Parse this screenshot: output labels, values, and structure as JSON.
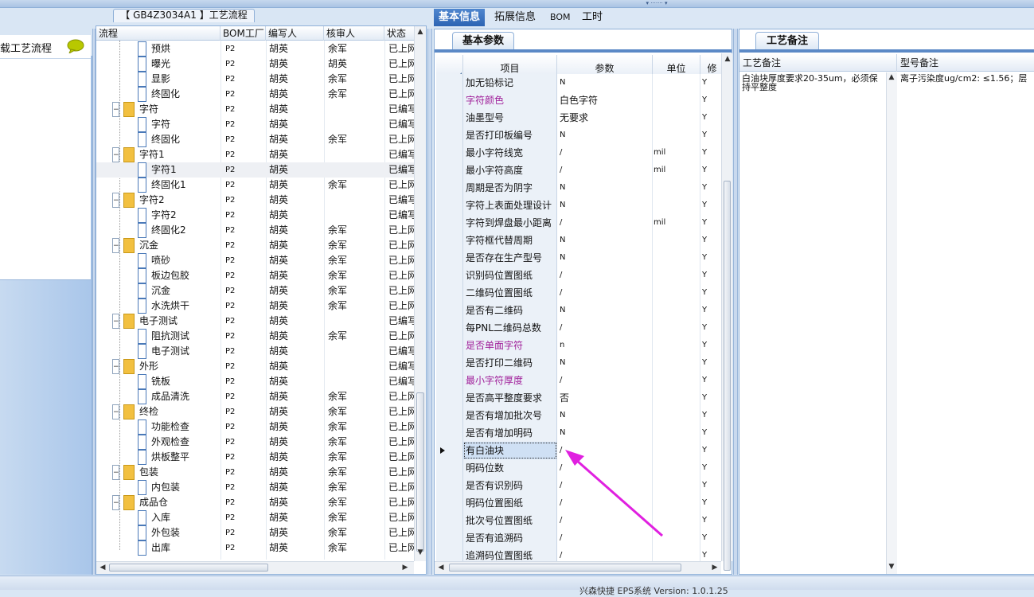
{
  "footer": {
    "version": "兴森快捷 EPS系统 Version: 1.0.1.25"
  },
  "left": {
    "item_label": "载工艺流程"
  },
  "tree": {
    "tab_label": "【 GB4Z3034A1 】工艺流程",
    "columns": [
      "流程",
      "BOM工厂",
      "编写人",
      "核审人",
      "状态"
    ],
    "rows": [
      {
        "type": "doc",
        "name": "预烘",
        "bom": "P2",
        "writer": "胡英",
        "reviewer": "余军",
        "status": "已上网"
      },
      {
        "type": "doc",
        "name": "曝光",
        "bom": "P2",
        "writer": "胡英",
        "reviewer": "胡英",
        "status": "已上网"
      },
      {
        "type": "doc",
        "name": "显影",
        "bom": "P2",
        "writer": "胡英",
        "reviewer": "余军",
        "status": "已上网"
      },
      {
        "type": "doc",
        "name": "终固化",
        "bom": "P2",
        "writer": "胡英",
        "reviewer": "余军",
        "status": "已上网"
      },
      {
        "type": "folder",
        "name": "字符",
        "bom": "P2",
        "writer": "胡英",
        "reviewer": "",
        "status": "已编写"
      },
      {
        "type": "doc",
        "name": "字符",
        "bom": "P2",
        "writer": "胡英",
        "reviewer": "",
        "status": "已编写"
      },
      {
        "type": "doc",
        "name": "终固化",
        "bom": "P2",
        "writer": "胡英",
        "reviewer": "余军",
        "status": "已上网"
      },
      {
        "type": "folder",
        "name": "字符1",
        "bom": "P2",
        "writer": "胡英",
        "reviewer": "",
        "status": "已编写"
      },
      {
        "type": "doc",
        "name": "字符1",
        "bom": "P2",
        "writer": "胡英",
        "reviewer": "",
        "status": "已编写",
        "selected": true
      },
      {
        "type": "doc",
        "name": "终固化1",
        "bom": "P2",
        "writer": "胡英",
        "reviewer": "余军",
        "status": "已上网"
      },
      {
        "type": "folder",
        "name": "字符2",
        "bom": "P2",
        "writer": "胡英",
        "reviewer": "",
        "status": "已编写"
      },
      {
        "type": "doc",
        "name": "字符2",
        "bom": "P2",
        "writer": "胡英",
        "reviewer": "",
        "status": "已编写"
      },
      {
        "type": "doc",
        "name": "终固化2",
        "bom": "P2",
        "writer": "胡英",
        "reviewer": "余军",
        "status": "已上网"
      },
      {
        "type": "folder",
        "name": "沉金",
        "bom": "P2",
        "writer": "胡英",
        "reviewer": "余军",
        "status": "已上网"
      },
      {
        "type": "doc",
        "name": "喷砂",
        "bom": "P2",
        "writer": "胡英",
        "reviewer": "余军",
        "status": "已上网"
      },
      {
        "type": "doc",
        "name": "板边包胶",
        "bom": "P2",
        "writer": "胡英",
        "reviewer": "余军",
        "status": "已上网"
      },
      {
        "type": "doc",
        "name": "沉金",
        "bom": "P2",
        "writer": "胡英",
        "reviewer": "余军",
        "status": "已上网"
      },
      {
        "type": "doc",
        "name": "水洗烘干",
        "bom": "P2",
        "writer": "胡英",
        "reviewer": "余军",
        "status": "已上网"
      },
      {
        "type": "folder",
        "name": "电子测试",
        "bom": "P2",
        "writer": "胡英",
        "reviewer": "",
        "status": "已编写"
      },
      {
        "type": "doc",
        "name": "阻抗测试",
        "bom": "P2",
        "writer": "胡英",
        "reviewer": "余军",
        "status": "已上网"
      },
      {
        "type": "doc",
        "name": "电子测试",
        "bom": "P2",
        "writer": "胡英",
        "reviewer": "",
        "status": "已编写"
      },
      {
        "type": "folder",
        "name": "外形",
        "bom": "P2",
        "writer": "胡英",
        "reviewer": "",
        "status": "已编写"
      },
      {
        "type": "doc",
        "name": "铣板",
        "bom": "P2",
        "writer": "胡英",
        "reviewer": "",
        "status": "已编写"
      },
      {
        "type": "doc",
        "name": "成品清洗",
        "bom": "P2",
        "writer": "胡英",
        "reviewer": "余军",
        "status": "已上网"
      },
      {
        "type": "folder",
        "name": "终检",
        "bom": "P2",
        "writer": "胡英",
        "reviewer": "余军",
        "status": "已上网"
      },
      {
        "type": "doc",
        "name": "功能检查",
        "bom": "P2",
        "writer": "胡英",
        "reviewer": "余军",
        "status": "已上网"
      },
      {
        "type": "doc",
        "name": "外观检查",
        "bom": "P2",
        "writer": "胡英",
        "reviewer": "余军",
        "status": "已上网"
      },
      {
        "type": "doc",
        "name": "烘板整平",
        "bom": "P2",
        "writer": "胡英",
        "reviewer": "余军",
        "status": "已上网"
      },
      {
        "type": "folder",
        "name": "包装",
        "bom": "P2",
        "writer": "胡英",
        "reviewer": "余军",
        "status": "已上网"
      },
      {
        "type": "doc",
        "name": "内包装",
        "bom": "P2",
        "writer": "胡英",
        "reviewer": "余军",
        "status": "已上网"
      },
      {
        "type": "folder",
        "name": "成品仓",
        "bom": "P2",
        "writer": "胡英",
        "reviewer": "余军",
        "status": "已上网"
      },
      {
        "type": "doc",
        "name": "入库",
        "bom": "P2",
        "writer": "胡英",
        "reviewer": "余军",
        "status": "已上网"
      },
      {
        "type": "doc",
        "name": "外包装",
        "bom": "P2",
        "writer": "胡英",
        "reviewer": "余军",
        "status": "已上网"
      },
      {
        "type": "doc",
        "name": "出库",
        "bom": "P2",
        "writer": "胡英",
        "reviewer": "余军",
        "status": "已上网"
      }
    ]
  },
  "main_tabs": [
    "基本信息",
    "拓展信息",
    "BOM",
    "工时"
  ],
  "params": {
    "subtab": "基本参数",
    "columns": [
      "项目",
      "参数",
      "单位",
      "修"
    ],
    "rows": [
      {
        "item": "加无铅标记",
        "value": "N",
        "unit": "",
        "flag": "Y"
      },
      {
        "item": "字符颜色",
        "value": "白色字符",
        "unit": "",
        "flag": "Y",
        "hl": true
      },
      {
        "item": "油墨型号",
        "value": "无要求",
        "unit": "",
        "flag": "Y"
      },
      {
        "item": "是否打印板编号",
        "value": "N",
        "unit": "",
        "flag": "Y"
      },
      {
        "item": "最小字符线宽",
        "value": "/",
        "unit": "mil",
        "flag": "Y"
      },
      {
        "item": "最小字符高度",
        "value": "/",
        "unit": "mil",
        "flag": "Y"
      },
      {
        "item": "周期是否为阴字",
        "value": "N",
        "unit": "",
        "flag": "Y"
      },
      {
        "item": "字符上表面处理设计",
        "value": "N",
        "unit": "",
        "flag": "Y"
      },
      {
        "item": "字符到焊盘最小距离",
        "value": "/",
        "unit": "mil",
        "flag": "Y"
      },
      {
        "item": "字符框代替周期",
        "value": "N",
        "unit": "",
        "flag": "Y"
      },
      {
        "item": "是否存在生产型号",
        "value": "N",
        "unit": "",
        "flag": "Y"
      },
      {
        "item": "识别码位置图纸",
        "value": "/",
        "unit": "",
        "flag": "Y"
      },
      {
        "item": "二维码位置图纸",
        "value": "/",
        "unit": "",
        "flag": "Y"
      },
      {
        "item": "是否有二维码",
        "value": "N",
        "unit": "",
        "flag": "Y"
      },
      {
        "item": "每PNL二维码总数",
        "value": "/",
        "unit": "",
        "flag": "Y"
      },
      {
        "item": "是否单面字符",
        "value": "n",
        "unit": "",
        "flag": "Y",
        "hl": true
      },
      {
        "item": "是否打印二维码",
        "value": "N",
        "unit": "",
        "flag": "Y"
      },
      {
        "item": "最小字符厚度",
        "value": "/",
        "unit": "",
        "flag": "Y",
        "hl": true
      },
      {
        "item": "是否高平整度要求",
        "value": "否",
        "unit": "",
        "flag": "Y"
      },
      {
        "item": "是否有增加批次号",
        "value": "N",
        "unit": "",
        "flag": "Y"
      },
      {
        "item": "是否有增加明码",
        "value": "N",
        "unit": "",
        "flag": "Y"
      },
      {
        "item": "有白油块",
        "value": "/",
        "unit": "",
        "flag": "Y",
        "current": true
      },
      {
        "item": "明码位数",
        "value": "/",
        "unit": "",
        "flag": "Y"
      },
      {
        "item": "是否有识别码",
        "value": "/",
        "unit": "",
        "flag": "Y"
      },
      {
        "item": "明码位置图纸",
        "value": "/",
        "unit": "",
        "flag": "Y"
      },
      {
        "item": "批次号位置图纸",
        "value": "/",
        "unit": "",
        "flag": "Y"
      },
      {
        "item": "是否有追溯码",
        "value": "/",
        "unit": "",
        "flag": "Y"
      },
      {
        "item": "追溯码位置图纸",
        "value": "/",
        "unit": "",
        "flag": "Y"
      }
    ]
  },
  "notes": {
    "subtab": "工艺备注",
    "columns": [
      "工艺备注",
      "型号备注"
    ],
    "process_note": "白油块厚度要求20-35um，必须保持平整度",
    "model_note": "离子污染度ug/cm2: ≤1.56；层"
  },
  "colors": {
    "accent": "#2d64b3",
    "highlight_text": "#a0209a",
    "annotation_arrow": "#e020e0"
  }
}
